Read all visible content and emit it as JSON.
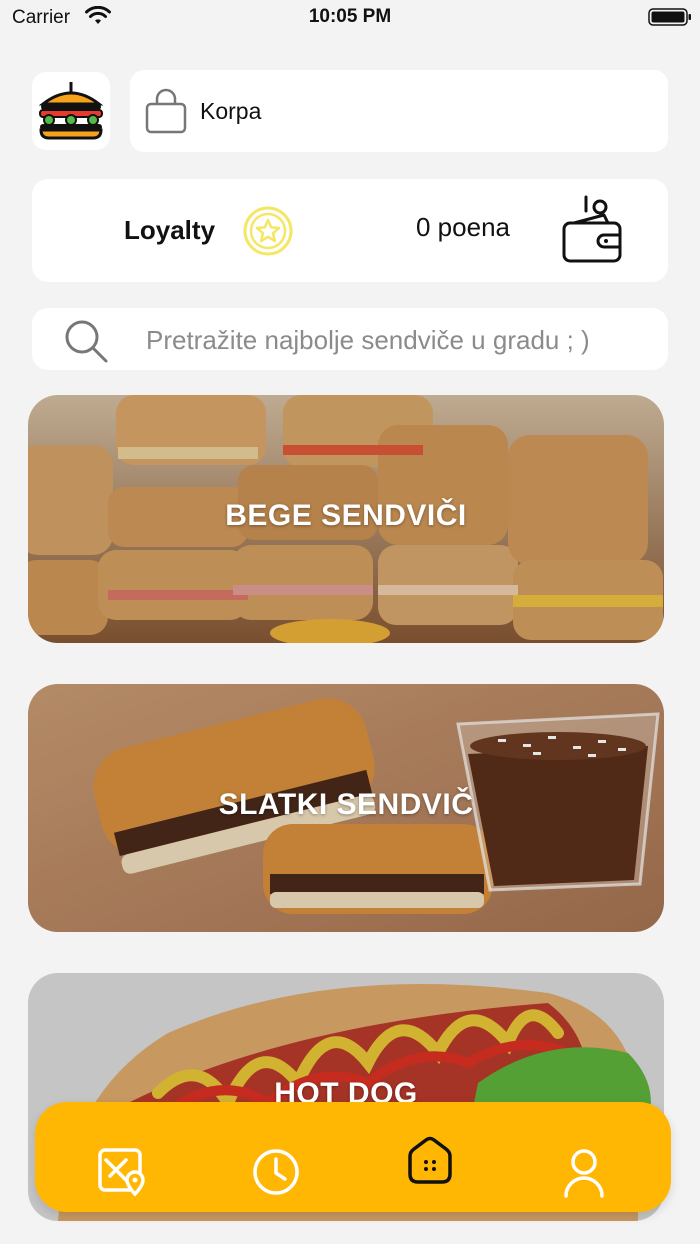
{
  "status_bar": {
    "carrier": "Carrier",
    "time": "10:05 PM"
  },
  "header": {
    "logo_icon": "sandwich-logo-icon",
    "cart_icon": "shopping-bag-icon",
    "cart_label": "Korpa"
  },
  "loyalty": {
    "label": "Loyalty",
    "star_icon": "star-badge-icon",
    "points_text": "0 poena",
    "wallet_icon": "wallet-coins-icon"
  },
  "search": {
    "icon": "search-icon",
    "placeholder": "Pretražite najbolje sendviče u gradu ; )"
  },
  "categories": [
    {
      "title": "BEGE SENDVIČI"
    },
    {
      "title": "SLATKI SENDVIČ"
    },
    {
      "title": "HOT DOG"
    }
  ],
  "bottom_nav": {
    "items": [
      {
        "icon": "map-location-icon"
      },
      {
        "icon": "clock-history-icon"
      },
      {
        "icon": "home-icon"
      },
      {
        "icon": "user-profile-icon"
      }
    ]
  },
  "colors": {
    "background": "#f3f3f3",
    "accent": "#ffb703",
    "star": "#f5e663"
  }
}
